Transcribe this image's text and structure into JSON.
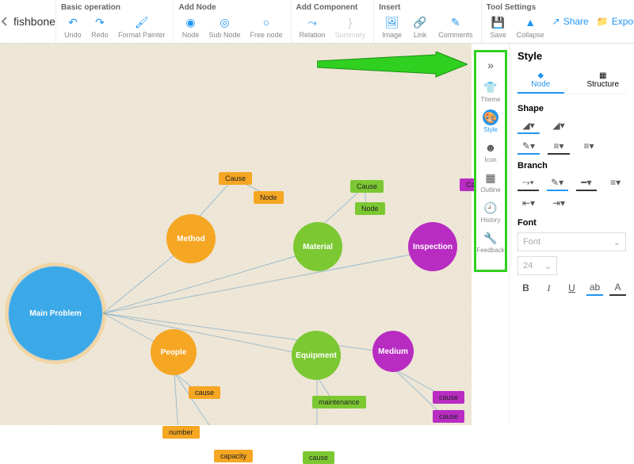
{
  "title": "fishbone",
  "toolbar": {
    "basic": {
      "title": "Basic operation",
      "undo": "Undo",
      "redo": "Redo",
      "fp": "Format Painter"
    },
    "addnode": {
      "title": "Add Node",
      "node": "Node",
      "subnode": "Sub Node",
      "freenode": "Free node"
    },
    "addcomp": {
      "title": "Add Component",
      "relation": "Relation",
      "summary": "Summary"
    },
    "insert": {
      "title": "Insert",
      "image": "Image",
      "link": "Link",
      "comments": "Comments"
    },
    "tool": {
      "title": "Tool Settings",
      "save": "Save",
      "collapse": "Collapse"
    },
    "share": "Share",
    "export": "Export"
  },
  "sidepanel": {
    "theme": "Theme",
    "style": "Style",
    "icon": "Icon",
    "outline": "Outline",
    "history": "History",
    "feedback": "Feedback"
  },
  "right": {
    "title": "Style",
    "tab_node": "Node",
    "tab_structure": "Structure",
    "shape": "Shape",
    "branch": "Branch",
    "font": "Font",
    "font_ph": "Font",
    "size": "24",
    "b": "B",
    "i": "I",
    "u": "U",
    "ab": "ab",
    "a": "A"
  },
  "nodes": {
    "main": "Main Problem",
    "method": "Method",
    "material": "Material",
    "inspection": "Inspection",
    "people": "People",
    "equipment": "Equipment",
    "medium": "Medium",
    "cause": "Cause",
    "node": "Node",
    "cause_l": "cause",
    "number": "number",
    "capacity": "capacity",
    "maintenance": "maintenance"
  }
}
